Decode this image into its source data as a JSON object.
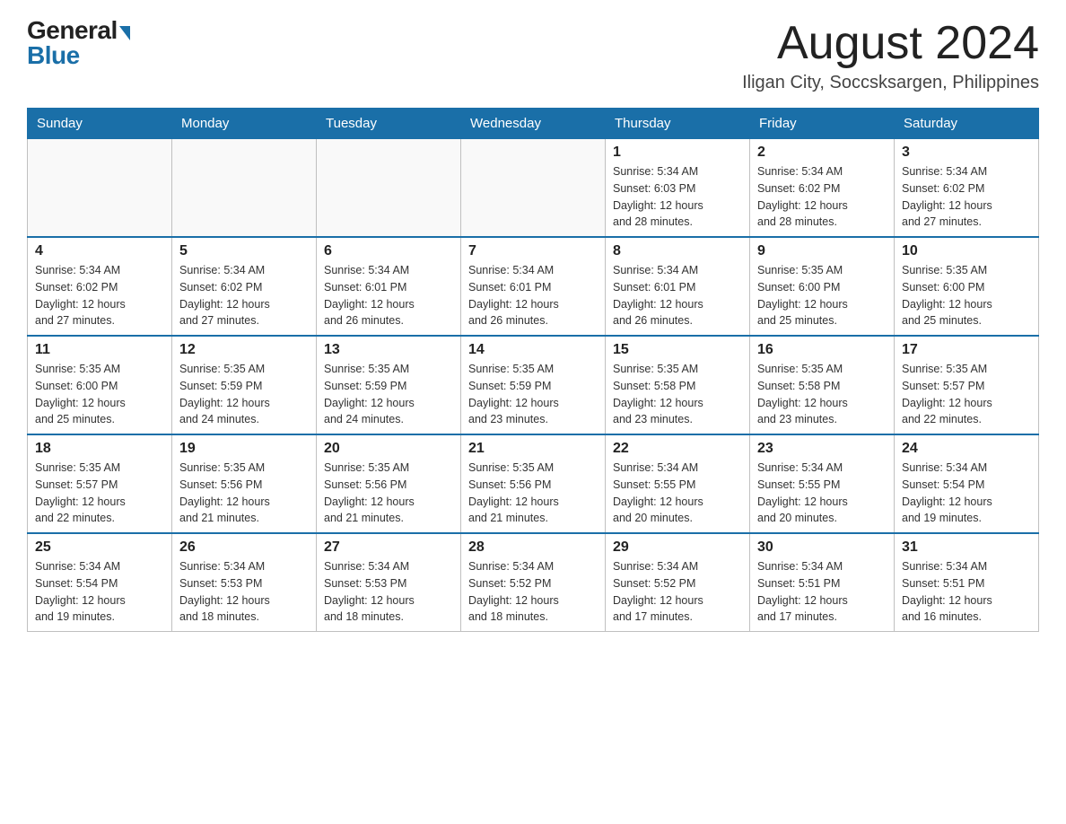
{
  "logo": {
    "general": "General",
    "blue": "Blue"
  },
  "title": "August 2024",
  "location": "Iligan City, Soccsksargen, Philippines",
  "days_of_week": [
    "Sunday",
    "Monday",
    "Tuesday",
    "Wednesday",
    "Thursday",
    "Friday",
    "Saturday"
  ],
  "weeks": [
    {
      "days": [
        {
          "num": "",
          "info": ""
        },
        {
          "num": "",
          "info": ""
        },
        {
          "num": "",
          "info": ""
        },
        {
          "num": "",
          "info": ""
        },
        {
          "num": "1",
          "info": "Sunrise: 5:34 AM\nSunset: 6:03 PM\nDaylight: 12 hours\nand 28 minutes."
        },
        {
          "num": "2",
          "info": "Sunrise: 5:34 AM\nSunset: 6:02 PM\nDaylight: 12 hours\nand 28 minutes."
        },
        {
          "num": "3",
          "info": "Sunrise: 5:34 AM\nSunset: 6:02 PM\nDaylight: 12 hours\nand 27 minutes."
        }
      ]
    },
    {
      "days": [
        {
          "num": "4",
          "info": "Sunrise: 5:34 AM\nSunset: 6:02 PM\nDaylight: 12 hours\nand 27 minutes."
        },
        {
          "num": "5",
          "info": "Sunrise: 5:34 AM\nSunset: 6:02 PM\nDaylight: 12 hours\nand 27 minutes."
        },
        {
          "num": "6",
          "info": "Sunrise: 5:34 AM\nSunset: 6:01 PM\nDaylight: 12 hours\nand 26 minutes."
        },
        {
          "num": "7",
          "info": "Sunrise: 5:34 AM\nSunset: 6:01 PM\nDaylight: 12 hours\nand 26 minutes."
        },
        {
          "num": "8",
          "info": "Sunrise: 5:34 AM\nSunset: 6:01 PM\nDaylight: 12 hours\nand 26 minutes."
        },
        {
          "num": "9",
          "info": "Sunrise: 5:35 AM\nSunset: 6:00 PM\nDaylight: 12 hours\nand 25 minutes."
        },
        {
          "num": "10",
          "info": "Sunrise: 5:35 AM\nSunset: 6:00 PM\nDaylight: 12 hours\nand 25 minutes."
        }
      ]
    },
    {
      "days": [
        {
          "num": "11",
          "info": "Sunrise: 5:35 AM\nSunset: 6:00 PM\nDaylight: 12 hours\nand 25 minutes."
        },
        {
          "num": "12",
          "info": "Sunrise: 5:35 AM\nSunset: 5:59 PM\nDaylight: 12 hours\nand 24 minutes."
        },
        {
          "num": "13",
          "info": "Sunrise: 5:35 AM\nSunset: 5:59 PM\nDaylight: 12 hours\nand 24 minutes."
        },
        {
          "num": "14",
          "info": "Sunrise: 5:35 AM\nSunset: 5:59 PM\nDaylight: 12 hours\nand 23 minutes."
        },
        {
          "num": "15",
          "info": "Sunrise: 5:35 AM\nSunset: 5:58 PM\nDaylight: 12 hours\nand 23 minutes."
        },
        {
          "num": "16",
          "info": "Sunrise: 5:35 AM\nSunset: 5:58 PM\nDaylight: 12 hours\nand 23 minutes."
        },
        {
          "num": "17",
          "info": "Sunrise: 5:35 AM\nSunset: 5:57 PM\nDaylight: 12 hours\nand 22 minutes."
        }
      ]
    },
    {
      "days": [
        {
          "num": "18",
          "info": "Sunrise: 5:35 AM\nSunset: 5:57 PM\nDaylight: 12 hours\nand 22 minutes."
        },
        {
          "num": "19",
          "info": "Sunrise: 5:35 AM\nSunset: 5:56 PM\nDaylight: 12 hours\nand 21 minutes."
        },
        {
          "num": "20",
          "info": "Sunrise: 5:35 AM\nSunset: 5:56 PM\nDaylight: 12 hours\nand 21 minutes."
        },
        {
          "num": "21",
          "info": "Sunrise: 5:35 AM\nSunset: 5:56 PM\nDaylight: 12 hours\nand 21 minutes."
        },
        {
          "num": "22",
          "info": "Sunrise: 5:34 AM\nSunset: 5:55 PM\nDaylight: 12 hours\nand 20 minutes."
        },
        {
          "num": "23",
          "info": "Sunrise: 5:34 AM\nSunset: 5:55 PM\nDaylight: 12 hours\nand 20 minutes."
        },
        {
          "num": "24",
          "info": "Sunrise: 5:34 AM\nSunset: 5:54 PM\nDaylight: 12 hours\nand 19 minutes."
        }
      ]
    },
    {
      "days": [
        {
          "num": "25",
          "info": "Sunrise: 5:34 AM\nSunset: 5:54 PM\nDaylight: 12 hours\nand 19 minutes."
        },
        {
          "num": "26",
          "info": "Sunrise: 5:34 AM\nSunset: 5:53 PM\nDaylight: 12 hours\nand 18 minutes."
        },
        {
          "num": "27",
          "info": "Sunrise: 5:34 AM\nSunset: 5:53 PM\nDaylight: 12 hours\nand 18 minutes."
        },
        {
          "num": "28",
          "info": "Sunrise: 5:34 AM\nSunset: 5:52 PM\nDaylight: 12 hours\nand 18 minutes."
        },
        {
          "num": "29",
          "info": "Sunrise: 5:34 AM\nSunset: 5:52 PM\nDaylight: 12 hours\nand 17 minutes."
        },
        {
          "num": "30",
          "info": "Sunrise: 5:34 AM\nSunset: 5:51 PM\nDaylight: 12 hours\nand 17 minutes."
        },
        {
          "num": "31",
          "info": "Sunrise: 5:34 AM\nSunset: 5:51 PM\nDaylight: 12 hours\nand 16 minutes."
        }
      ]
    }
  ]
}
